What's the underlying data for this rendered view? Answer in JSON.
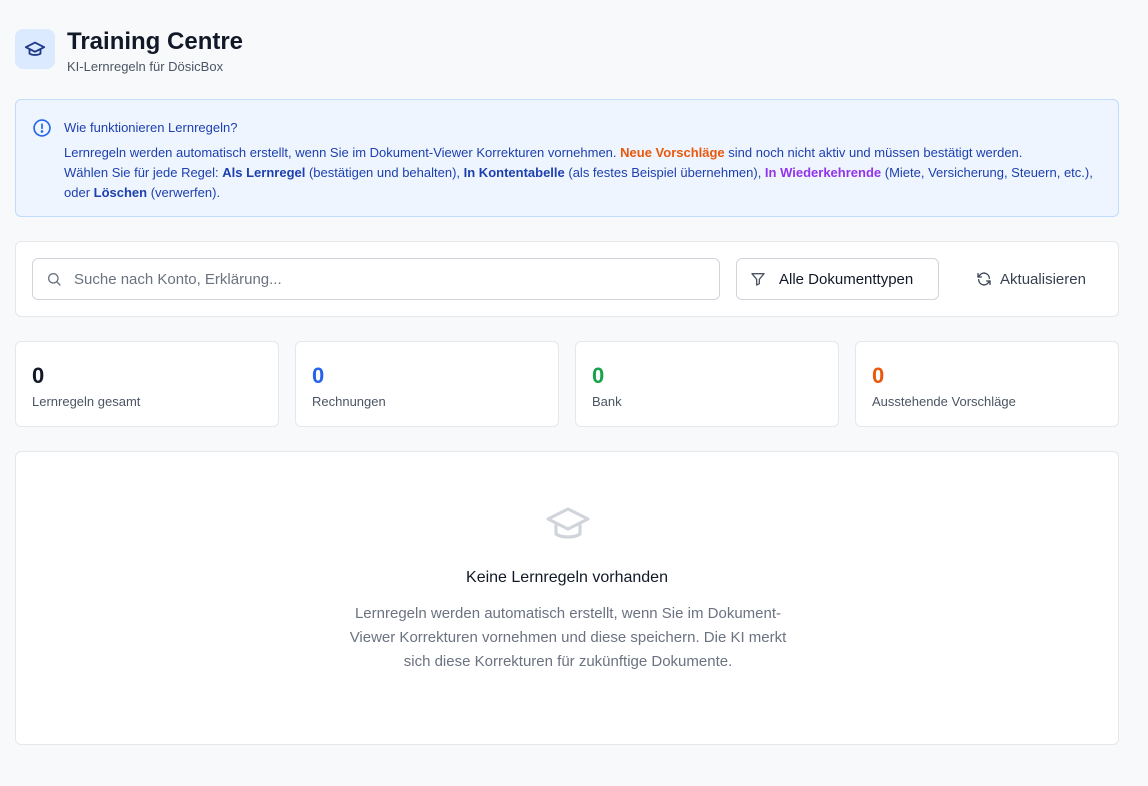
{
  "header": {
    "title": "Training Centre",
    "subtitle": "KI-Lernregeln für DösicBox",
    "icon": "graduation-cap-icon"
  },
  "info": {
    "title": "Wie funktionieren Lernregeln?",
    "line1_prefix": "Lernregeln werden automatisch erstellt, wenn Sie im Dokument-Viewer Korrekturen vornehmen. ",
    "line1_highlight": "Neue Vorschläge",
    "line1_suffix": " sind noch nicht aktiv und müssen bestätigt werden.",
    "line2_prefix": "Wählen Sie für jede Regel: ",
    "opt1": "Als Lernregel",
    "opt1_desc": " (bestätigen und behalten), ",
    "opt2": "In Kontentabelle",
    "opt2_desc": " (als festes Beispiel übernehmen), ",
    "opt3": "In Wiederkehrende",
    "opt3_desc": " (Miete, Versicherung, Steuern, etc.), oder ",
    "opt4": "Löschen",
    "opt4_desc": " (verwerfen)."
  },
  "toolbar": {
    "search_placeholder": "Suche nach Konto, Erklärung...",
    "search_value": "",
    "filter_label": "Alle Dokumenttypen",
    "refresh_label": "Aktualisieren"
  },
  "stats": [
    {
      "value": "0",
      "label": "Lernregeln gesamt",
      "color": "#111827"
    },
    {
      "value": "0",
      "label": "Rechnungen",
      "color": "#2563eb"
    },
    {
      "value": "0",
      "label": "Bank",
      "color": "#16a34a"
    },
    {
      "value": "0",
      "label": "Ausstehende Vorschläge",
      "color": "#ea580c"
    }
  ],
  "empty_state": {
    "title": "Keine Lernregeln vorhanden",
    "description": "Lernregeln werden automatisch erstellt, wenn Sie im Dokument-Viewer Korrekturen vornehmen und diese speichern. Die KI merkt sich diese Korrekturen für zukünftige Dokumente."
  },
  "colors": {
    "accent": "#2563eb",
    "info_bg": "#eef5ff",
    "highlight_orange": "#ea580c",
    "highlight_purple": "#9333ea"
  }
}
